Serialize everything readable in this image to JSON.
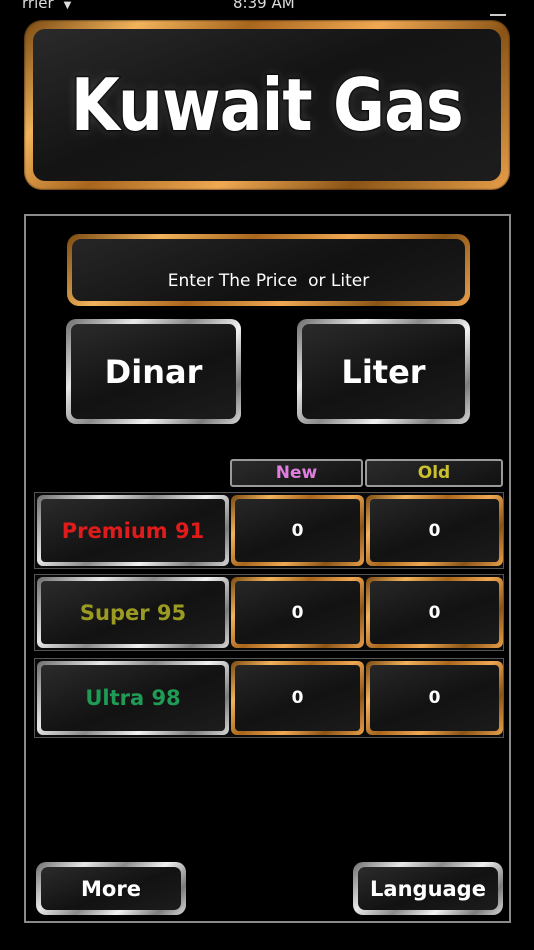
{
  "status_bar": {
    "carrier": "rrier",
    "time": "8:39 AM"
  },
  "header": {
    "title": "Kuwait Gas"
  },
  "price_input": {
    "placeholder": "Enter The Price  or Liter",
    "value": ""
  },
  "unit_buttons": {
    "dinar_label": "Dinar",
    "liter_label": "Liter"
  },
  "columns": {
    "new_label": "New",
    "old_label": "Old",
    "new_color": "#e07de0",
    "old_color": "#c9c12e"
  },
  "fuels": [
    {
      "label": "Premium 91",
      "color": "#e01b1b",
      "new_value": "0",
      "old_value": "0"
    },
    {
      "label": "Super 95",
      "color": "#9b9b22",
      "new_value": "0",
      "old_value": "0"
    },
    {
      "label": "Ultra 98",
      "color": "#1f9b55",
      "new_value": "0",
      "old_value": "0"
    }
  ],
  "footer": {
    "more_label": "More",
    "language_label": "Language"
  },
  "icons": {
    "wifi": "wifi-icon",
    "battery": "battery-icon",
    "cursor": "mouse-cursor-icon"
  }
}
